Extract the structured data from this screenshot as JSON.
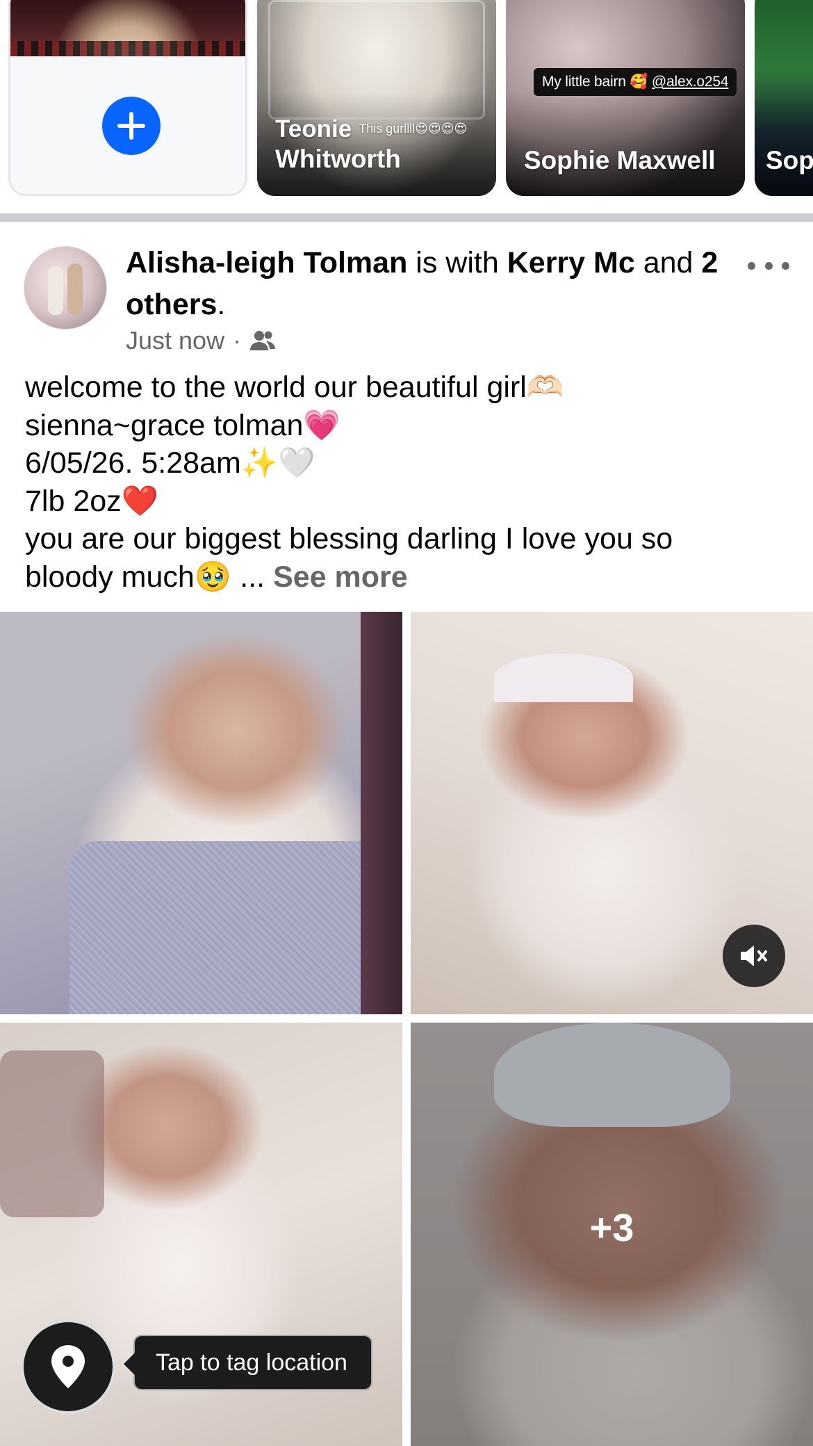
{
  "stories": {
    "create": {
      "label": "Create\nstory",
      "accent": "#0866ff"
    },
    "items": [
      {
        "name": "Teonie Whitworth",
        "line1": "Teonie",
        "line2": "Whitworth",
        "caption": "This gurllll😍😍😍😍"
      },
      {
        "name": "Sophie Maxwell",
        "sticker_text": "My little bairn 🥰 ",
        "sticker_handle": "@alex.o254"
      },
      {
        "name": "Sop"
      }
    ]
  },
  "post": {
    "author": "Alisha-leigh Tolman",
    "with_text": " is with ",
    "tagged": "Kerry Mc",
    "and_text": " and ",
    "others": "2 others",
    "period": ".",
    "time": "Just now",
    "separator": "·",
    "audience_icon": "friends-icon",
    "text_lines": [
      "welcome to the world our beautiful girl🫶🏻",
      "sienna~grace tolman💗",
      "6/05/26.  5:28am✨🤍",
      "7lb 2oz❤️",
      "you are our biggest blessing darling I love you so",
      "bloody much🥹 ..."
    ],
    "see_more": "See more"
  },
  "media": {
    "photos": [
      "newborn-photo-1",
      "newborn-video-2",
      "newborn-photo-3",
      "newborn-photo-4"
    ],
    "more_count": "+3"
  },
  "overlays": {
    "tag_location": "Tap to tag location",
    "mute_icon": "speaker-muted-icon",
    "location_icon": "location-pin-icon"
  }
}
